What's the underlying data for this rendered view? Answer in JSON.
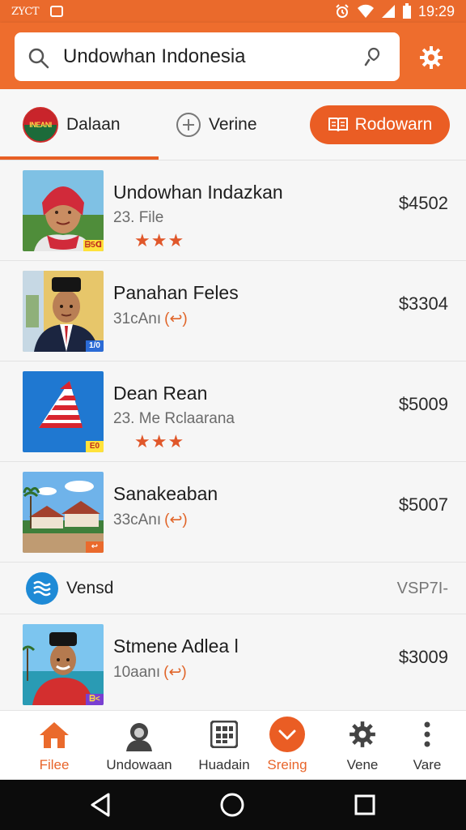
{
  "status_bar": {
    "left_text": "ZYCT",
    "time": "19:29"
  },
  "search": {
    "value": "Undowhan Indonesia"
  },
  "tabs": [
    {
      "label": "Dalaan",
      "badge_text": "INEANI"
    },
    {
      "label": "Verine"
    },
    {
      "label": "Rodowarn"
    }
  ],
  "items": [
    {
      "title": "Undowhan Indazkan",
      "subtitle": "23. File",
      "price": "$4502",
      "stars": "★★★",
      "tag": "ᗷ5ᗡ"
    },
    {
      "title": "Panahan Feles",
      "subtitle": "31cAnı",
      "paren": "(↩)",
      "price": "$3304",
      "tag": "1/0"
    },
    {
      "title": "Dean Rean",
      "subtitle": "23. Me Rclaarana",
      "price": "$5009",
      "stars": "★★★",
      "tag": "E0"
    },
    {
      "title": "Sanakeaban",
      "subtitle": "33cAnı",
      "paren": "(↩)",
      "price": "$5007",
      "tag": "↩"
    }
  ],
  "section": {
    "label": "Vensd",
    "right": "VSP7I-"
  },
  "last_item": {
    "title": "Stmene Adlea l",
    "subtitle": "10aanı",
    "paren": "(↩)",
    "price": "$3009",
    "tag": "ᗷ<"
  },
  "bottom_nav": [
    {
      "label": "Filee",
      "icon": "home-icon"
    },
    {
      "label": "Undowaan",
      "icon": "user-icon"
    },
    {
      "label": "Huadain",
      "icon": "grid-icon"
    },
    {
      "label": "Sreing",
      "icon": "chevron-down-icon"
    },
    {
      "label": "Vene",
      "icon": "gear-icon"
    },
    {
      "label": "Vare",
      "icon": "more-vertical-icon"
    }
  ],
  "colors": {
    "accent": "#EA6A2C",
    "accent_dark": "#E85F25",
    "star": "#E0572A",
    "system_nav": "#0C0C0C"
  }
}
